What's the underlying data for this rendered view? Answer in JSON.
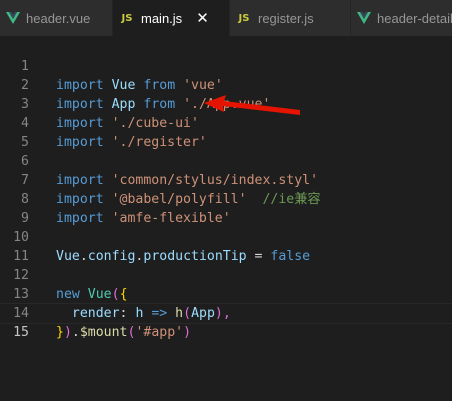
{
  "tabs": [
    {
      "label": "header.vue",
      "icon": "vue-icon",
      "active": false
    },
    {
      "label": "main.js",
      "icon": "js-icon",
      "active": true,
      "close": "✕"
    },
    {
      "label": "register.js",
      "icon": "js-icon",
      "active": false
    },
    {
      "label": "header-detail.vue",
      "icon": "vue-icon",
      "active": false
    }
  ],
  "js_badge": "JS",
  "code": {
    "line_numbers": [
      "1",
      "2",
      "3",
      "4",
      "5",
      "6",
      "7",
      "8",
      "9",
      "10",
      "11",
      "12",
      "13",
      "14",
      "15"
    ],
    "lines": [
      [
        "import",
        " ",
        "Vue",
        " ",
        "from",
        " ",
        "'vue'"
      ],
      [
        "import",
        " ",
        "App",
        " ",
        "from",
        " ",
        "'./App.vue'"
      ],
      [
        "import",
        " ",
        "'./cube-ui'"
      ],
      [
        "import",
        " ",
        "'./register'"
      ],
      [],
      [
        "import",
        " ",
        "'common/stylus/index.styl'"
      ],
      [
        "import",
        " ",
        "'@babel/polyfill'",
        "  ",
        "//ie兼容"
      ],
      [
        "import",
        " ",
        "'amfe-flexible'"
      ],
      [],
      [
        "Vue",
        ".",
        "config",
        ".",
        "productionTip",
        " = ",
        "false"
      ],
      [],
      [
        "new",
        " ",
        "Vue",
        "(",
        "{"
      ],
      [
        "  ",
        "render",
        ":",
        " ",
        "h",
        " => ",
        "h",
        "(",
        "App",
        "),"
      ],
      [
        "}",
        ")",
        ".",
        "$mount",
        "(",
        "'#app'",
        ")"
      ],
      []
    ]
  },
  "colors": {
    "background": "#1e1e1e",
    "keyword": "#569cd6",
    "string": "#ce9178",
    "identifier": "#9cdcfe",
    "comment": "#6a9955",
    "annotation_arrow": "#e51400"
  }
}
